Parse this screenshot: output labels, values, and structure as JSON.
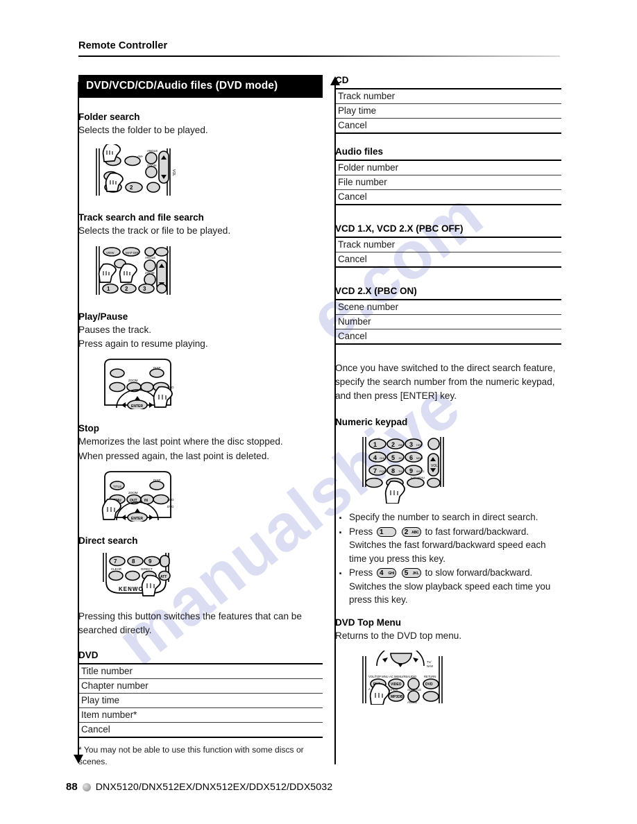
{
  "header": {
    "title": "Remote Controller"
  },
  "left": {
    "banner": "DVD/VCD/CD/Audio files (DVD mode)",
    "sections": [
      {
        "title": "Folder search",
        "body": "Selects the folder to be played."
      },
      {
        "title": "Track search and file search",
        "body": "Selects the track or file to be played."
      },
      {
        "title": "Play/Pause",
        "body_line1": "Pauses the track.",
        "body_line2": "Press again to resume playing."
      },
      {
        "title": "Stop",
        "body_line1": "Memorizes the last point where the disc stopped.",
        "body_line2": "When pressed again, the last point is deleted."
      },
      {
        "title": "Direct search"
      }
    ],
    "direct_search_body": "Pressing this button switches the features that can be searched directly.",
    "dvd_table": {
      "title": "DVD",
      "rows": [
        "Title number",
        "Chapter number",
        "Play time",
        "Item number*",
        "Cancel"
      ]
    },
    "footnote": "* You may not be able to use this function with some discs or scenes."
  },
  "right": {
    "cd_table": {
      "title": "CD",
      "rows": [
        "Track number",
        "Play time",
        "Cancel"
      ]
    },
    "audio_table": {
      "title": "Audio files",
      "rows": [
        "Folder number",
        "File number",
        "Cancel"
      ]
    },
    "vcd1_table": {
      "title": "VCD 1.X, VCD 2.X (PBC OFF)",
      "rows": [
        "Track number",
        "Cancel"
      ]
    },
    "vcd2_table": {
      "title": "VCD 2.X (PBC ON)",
      "rows": [
        "Scene number",
        "Number",
        "Cancel"
      ]
    },
    "direct_note": "Once you have switched to the direct search feature, specify the search number from the numeric keypad, and then press [ENTER] key.",
    "numeric_keypad_title": "Numeric keypad",
    "bullets": [
      {
        "type": "plain",
        "text": "Specify the number to search in direct search."
      },
      {
        "type": "keys",
        "prefix": "Press",
        "keys": [
          {
            "num": "1",
            "sub": ""
          },
          {
            "num": "2",
            "sub": "ABC"
          }
        ],
        "suffix": "to fast forward/backward.",
        "continuation": "Switches the fast forward/backward speed each time you press this key."
      },
      {
        "type": "keys",
        "prefix": "Press",
        "keys": [
          {
            "num": "4",
            "sub": "GHI"
          },
          {
            "num": "5",
            "sub": "JKL"
          }
        ],
        "suffix": "to slow forward/backward.",
        "continuation": "Switches the slow playback speed each time you press this key."
      }
    ],
    "dvd_top_menu": {
      "title": "DVD Top Menu",
      "body": "Returns to the DVD top menu."
    }
  },
  "footer": {
    "page_number": "88",
    "models": "DNX5120/DNX512EX/DNX512EX/DDX512/DDX5032"
  },
  "watermark": {
    "line1": "manualshive",
    "line2": "e.com"
  }
}
